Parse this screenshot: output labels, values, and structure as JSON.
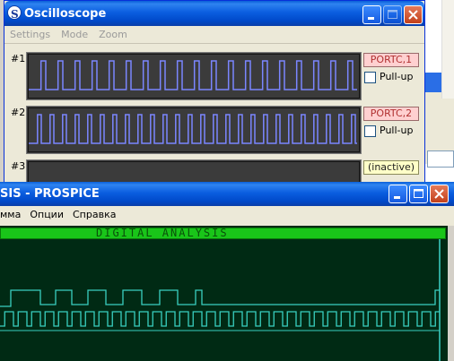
{
  "oscilloscope": {
    "title": "Oscilloscope",
    "menu": [
      "Settings",
      "Mode",
      "Zoom"
    ],
    "channels": [
      {
        "label": "#1",
        "pin": "PORTC,1",
        "pullup": "Pull-up"
      },
      {
        "label": "#2",
        "pin": "PORTC,2",
        "pullup": "Pull-up"
      },
      {
        "label": "#3",
        "pin": "(inactive)"
      }
    ]
  },
  "prospice": {
    "title": "SIS - PROSPICE",
    "menu": [
      "мма",
      "Опции",
      "Справка"
    ],
    "graph_title": "DIGITAL ANALYSIS"
  },
  "colors": {
    "trace_osc": "#7b86ff",
    "trace_green": "#39cfc0",
    "graph_bg": "#002a14",
    "graph_header": "#19c519"
  }
}
